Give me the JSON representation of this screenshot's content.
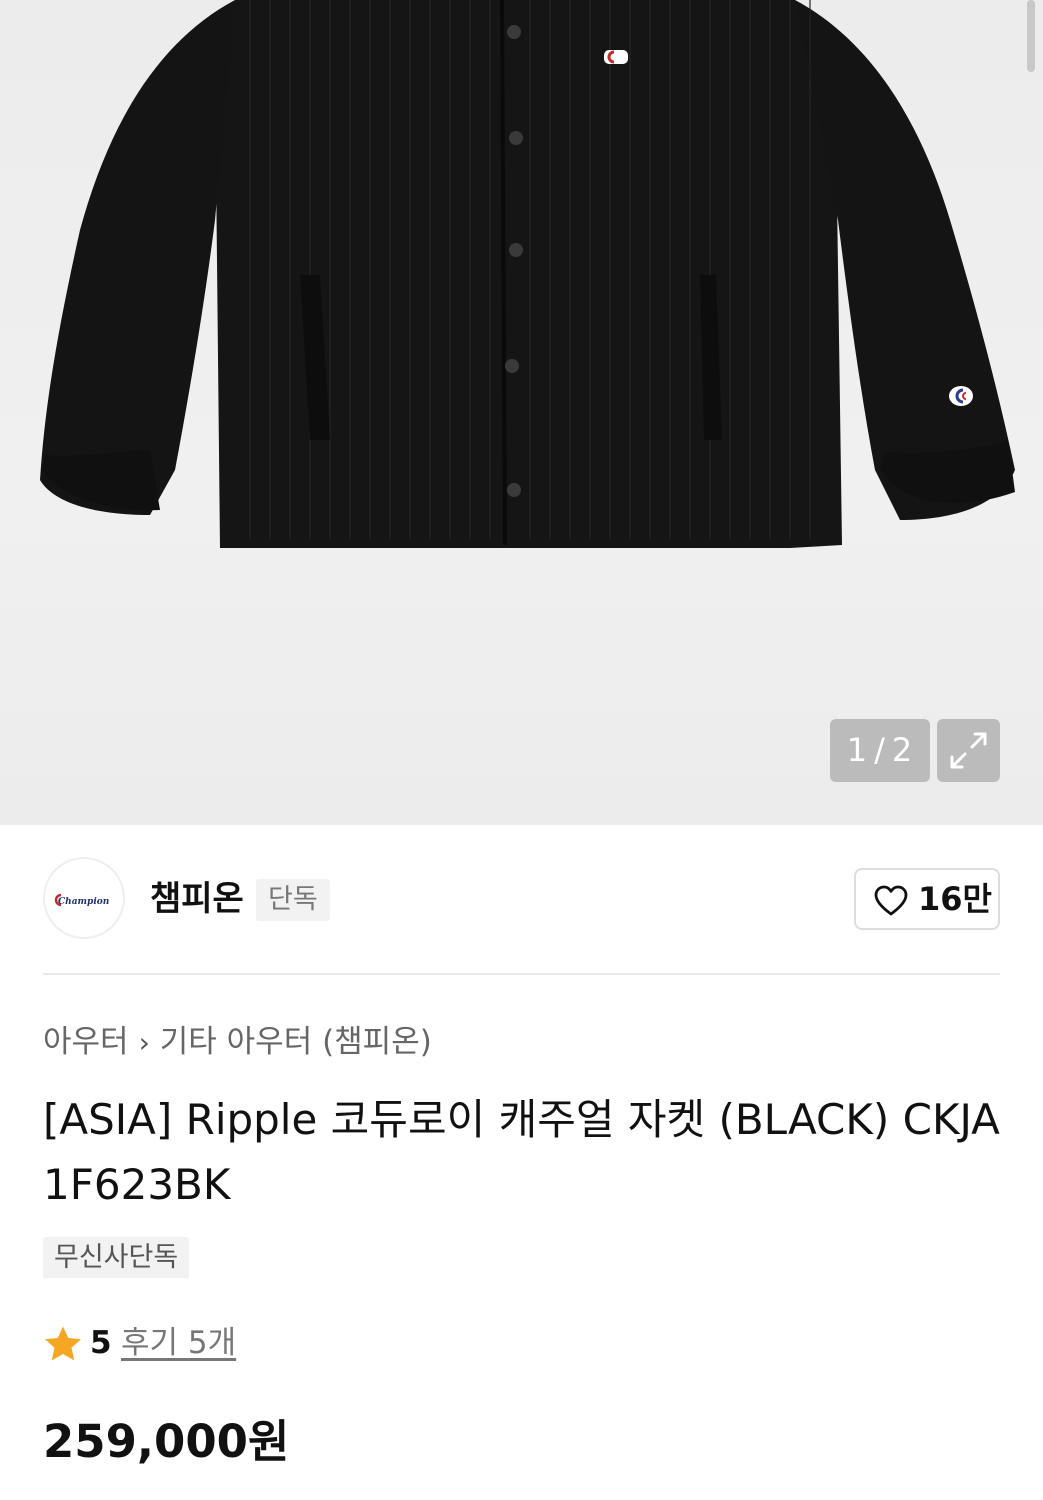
{
  "gallery": {
    "current": "1",
    "separator": "/",
    "total": "2",
    "expand_icon": "expand-icon"
  },
  "brand": {
    "logo_text": "Champion",
    "name": "챔피온",
    "badge": "단독",
    "like_icon": "heart-outline-icon",
    "like_count": "16만"
  },
  "breadcrumb": {
    "level1": "아우터",
    "chevron": "›",
    "level2": "기타 아우터 (챔피온)"
  },
  "product": {
    "title": "[ASIA] Ripple 코듀로이 캐주얼 자켓 (BLACK) CKJA1F623BK",
    "tag": "무신사단독",
    "rating_icon": "star-icon",
    "rating": "5",
    "review_text": "후기 5개",
    "price": "259,000원"
  },
  "colors": {
    "star": "#F5A623",
    "text": "#111111",
    "muted": "#777777"
  }
}
